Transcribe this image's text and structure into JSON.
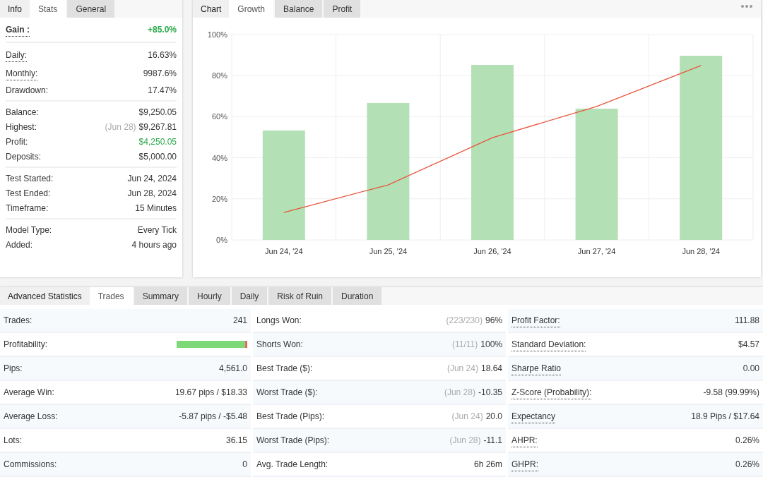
{
  "info_panel": {
    "heading": "Info",
    "tabs": [
      {
        "label": "Stats",
        "selected": true
      },
      {
        "label": "General",
        "selected": false
      }
    ],
    "groups": [
      [
        {
          "label": "Gain :",
          "value": "+85.0%",
          "dotted": true,
          "emphasis": true,
          "positive": true
        }
      ],
      [
        {
          "label": "Daily:",
          "value": "16.63%",
          "dotted": true
        },
        {
          "label": "Monthly:",
          "value": "9987.6%",
          "dotted": true
        },
        {
          "label": "Drawdown:",
          "value": "17.47%",
          "dotted": false
        }
      ],
      [
        {
          "label": "Balance:",
          "value": "$9,250.05"
        },
        {
          "label": "Highest:",
          "note": "(Jun 28)",
          "value": "$9,267.81"
        },
        {
          "label": "Profit:",
          "value": "$4,250.05",
          "positive": true
        },
        {
          "label": "Deposits:",
          "value": "$5,000.00"
        }
      ],
      [
        {
          "label": "Test Started:",
          "value": "Jun 24, 2024"
        },
        {
          "label": "Test Ended:",
          "value": "Jun 28, 2024"
        },
        {
          "label": "Timeframe:",
          "value": "15 Minutes"
        }
      ],
      [
        {
          "label": "Model Type:",
          "value": "Every Tick"
        },
        {
          "label": "Added:",
          "value": "4 hours ago"
        }
      ]
    ]
  },
  "chart_panel": {
    "heading": "Chart",
    "tabs": [
      {
        "label": "Growth",
        "selected": true
      },
      {
        "label": "Balance",
        "selected": false
      },
      {
        "label": "Profit",
        "selected": false
      }
    ],
    "chart_data": {
      "type": "bar",
      "grid": true,
      "categories": [
        "Jun 24, '24",
        "Jun 25, '24",
        "Jun 26, '24",
        "Jun 27, '24",
        "Jun 28, '24"
      ],
      "ylim": [
        0,
        100
      ],
      "yticks": [
        {
          "value": 0,
          "label": "0%"
        },
        {
          "value": 20,
          "label": "20%"
        },
        {
          "value": 40,
          "label": "40%"
        },
        {
          "value": 60,
          "label": "60%"
        },
        {
          "value": 80,
          "label": "80%"
        },
        {
          "value": 100,
          "label": "100%"
        }
      ],
      "series": [
        {
          "type": "bar",
          "color": "#b3e0b5",
          "values": [
            53.3,
            66.7,
            85.2,
            63.9,
            89.7
          ]
        },
        {
          "type": "line",
          "color": "#e8553c",
          "values": [
            13.4,
            26.8,
            49.8,
            65.0,
            84.9
          ]
        }
      ]
    }
  },
  "advanced_panel": {
    "heading": "Advanced Statistics",
    "tabs": [
      {
        "label": "Trades",
        "selected": true
      },
      {
        "label": "Summary",
        "selected": false
      },
      {
        "label": "Hourly",
        "selected": false
      },
      {
        "label": "Daily",
        "selected": false
      },
      {
        "label": "Risk of Ruin",
        "selected": false
      },
      {
        "label": "Duration",
        "selected": false
      }
    ],
    "columns": [
      [
        {
          "kind": "text",
          "label": "Trades:",
          "value": "241"
        },
        {
          "kind": "bar",
          "label": "Profitability:",
          "level": 0.97
        },
        {
          "kind": "text",
          "label": "Pips:",
          "value": "4,561.0"
        },
        {
          "kind": "text",
          "label": "Average Win:",
          "value": "19.67 pips / $18.33"
        },
        {
          "kind": "text",
          "label": "Average Loss:",
          "value": "-5.87 pips / -$5.48"
        },
        {
          "kind": "text",
          "label": "Lots:",
          "value": "36.15"
        },
        {
          "kind": "text",
          "label": "Commissions:",
          "value": "0"
        }
      ],
      [
        {
          "kind": "text",
          "label": "Longs Won:",
          "note": "(223/230)",
          "value": "96%"
        },
        {
          "kind": "text",
          "label": "Shorts Won:",
          "note": "(11/11)",
          "value": "100%"
        },
        {
          "kind": "text",
          "label": "Best Trade ($):",
          "note": "(Jun 24)",
          "value": "18.64"
        },
        {
          "kind": "text",
          "label": "Worst Trade ($):",
          "note": "(Jun 28)",
          "value": "-10.35"
        },
        {
          "kind": "text",
          "label": "Best Trade (Pips):",
          "note": "(Jun 24)",
          "value": "20.0"
        },
        {
          "kind": "text",
          "label": "Worst Trade (Pips):",
          "note": "(Jun 28)",
          "value": "-11.1"
        },
        {
          "kind": "text",
          "label": "Avg. Trade Length:",
          "value": "6h 26m"
        }
      ],
      [
        {
          "kind": "text",
          "label": "Profit Factor:",
          "value": "111.88",
          "dotted": true
        },
        {
          "kind": "text",
          "label": "Standard Deviation:",
          "value": "$4.57",
          "dotted": true
        },
        {
          "kind": "text",
          "label": "Sharpe Ratio",
          "value": "0.00",
          "dotted": true
        },
        {
          "kind": "text",
          "label": "Z-Score (Probability):",
          "value": "-9.58 (99.99%)",
          "dotted": true
        },
        {
          "kind": "text",
          "label": "Expectancy",
          "value": "18.9 Pips / $17.64",
          "dotted": true
        },
        {
          "kind": "text",
          "label": "AHPR:",
          "value": "0.26%",
          "dotted": true
        },
        {
          "kind": "text",
          "label": "GHPR:",
          "value": "0.26%",
          "dotted": true
        }
      ]
    ]
  }
}
